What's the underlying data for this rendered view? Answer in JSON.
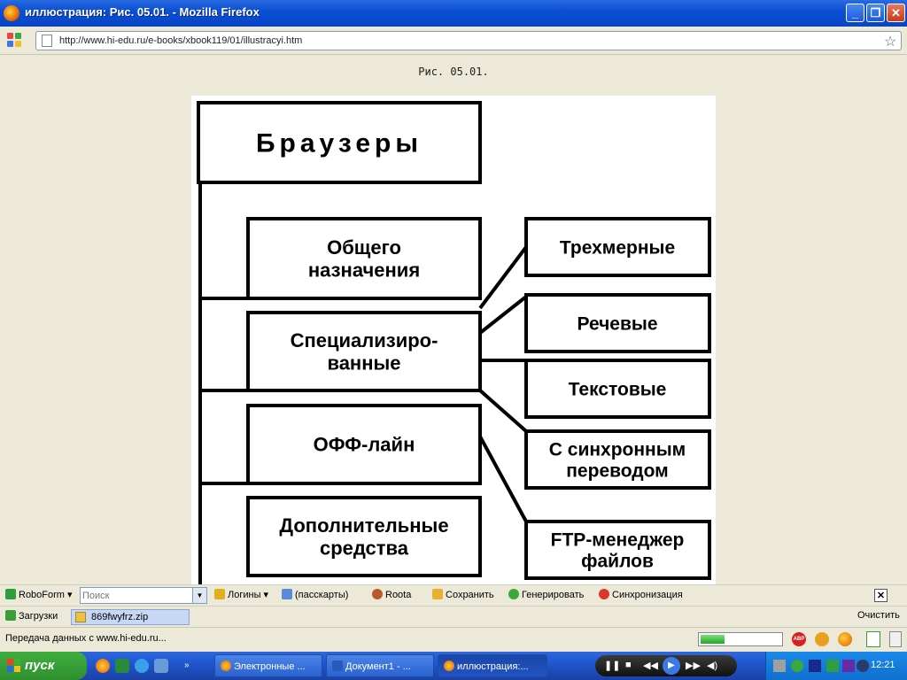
{
  "window": {
    "title": "иллюстрация: Рис. 05.01. - Mozilla Firefox"
  },
  "nav": {
    "url": "http://www.hi-edu.ru/e-books/xbook119/01/illustracyi.htm"
  },
  "page": {
    "caption": "Рис. 05.01."
  },
  "diagram": {
    "root": "Браузеры",
    "categories": [
      [
        "Общего",
        "назначения"
      ],
      [
        "Специализиро-",
        "ванные"
      ],
      [
        "ОФФ-лайн"
      ],
      [
        "Дополнительные",
        "средства"
      ]
    ],
    "specialized": [
      [
        "Трехмерные"
      ],
      [
        "Речевые"
      ],
      [
        "Текстовые"
      ],
      [
        "С синхронным",
        "переводом"
      ],
      [
        "FTP-менеджер",
        "файлов"
      ]
    ]
  },
  "toolbar": {
    "roboform": "RoboForm",
    "search_placeholder": "Поиск",
    "logins": "Логины",
    "passcards": "(пасскарты)",
    "roota": "Roota",
    "save": "Сохранить",
    "generate": "Генерировать",
    "sync": "Синхронизация"
  },
  "downloads": {
    "label": "Загрузки",
    "file": "869fwyfrz.zip",
    "clear": "Очистить"
  },
  "status": {
    "text": "Передача данных с www.hi-edu.ru...",
    "progress": 0.3
  },
  "taskbar": {
    "start": "пуск",
    "windows": [
      "Электронные ...",
      "Документ1 - ...",
      "иллюстрация:..."
    ],
    "clock": "12:21"
  },
  "colors": {
    "titlebar": "#0a4fd6",
    "taskbar": "#245edb",
    "start": "#3a9e3a"
  }
}
